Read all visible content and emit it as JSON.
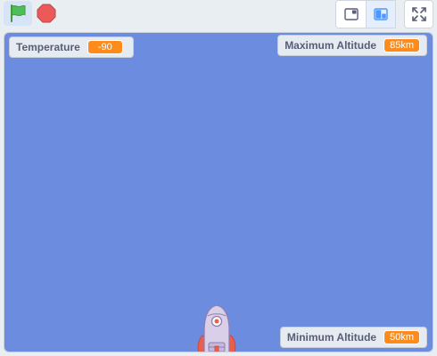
{
  "toolbar": {
    "green_flag_icon": "green-flag-icon",
    "stop_icon": "stop-icon",
    "small_stage_icon": "small-stage-icon",
    "normal_stage_icon": "normal-stage-icon",
    "fullscreen_icon": "fullscreen-icon"
  },
  "monitors": {
    "temperature": {
      "label": "Temperature",
      "value": "-90"
    },
    "max_altitude": {
      "label": "Maximum Altitude",
      "value": "85km"
    },
    "min_altitude": {
      "label": "Minimum Altitude",
      "value": "50km"
    }
  },
  "colors": {
    "stage_background": "#6c8ce0",
    "monitor_value": "#ff8c1a",
    "green_flag": "#4cbf56",
    "stop": "#ec5959"
  },
  "sprite": {
    "icon": "rocket-sprite"
  }
}
